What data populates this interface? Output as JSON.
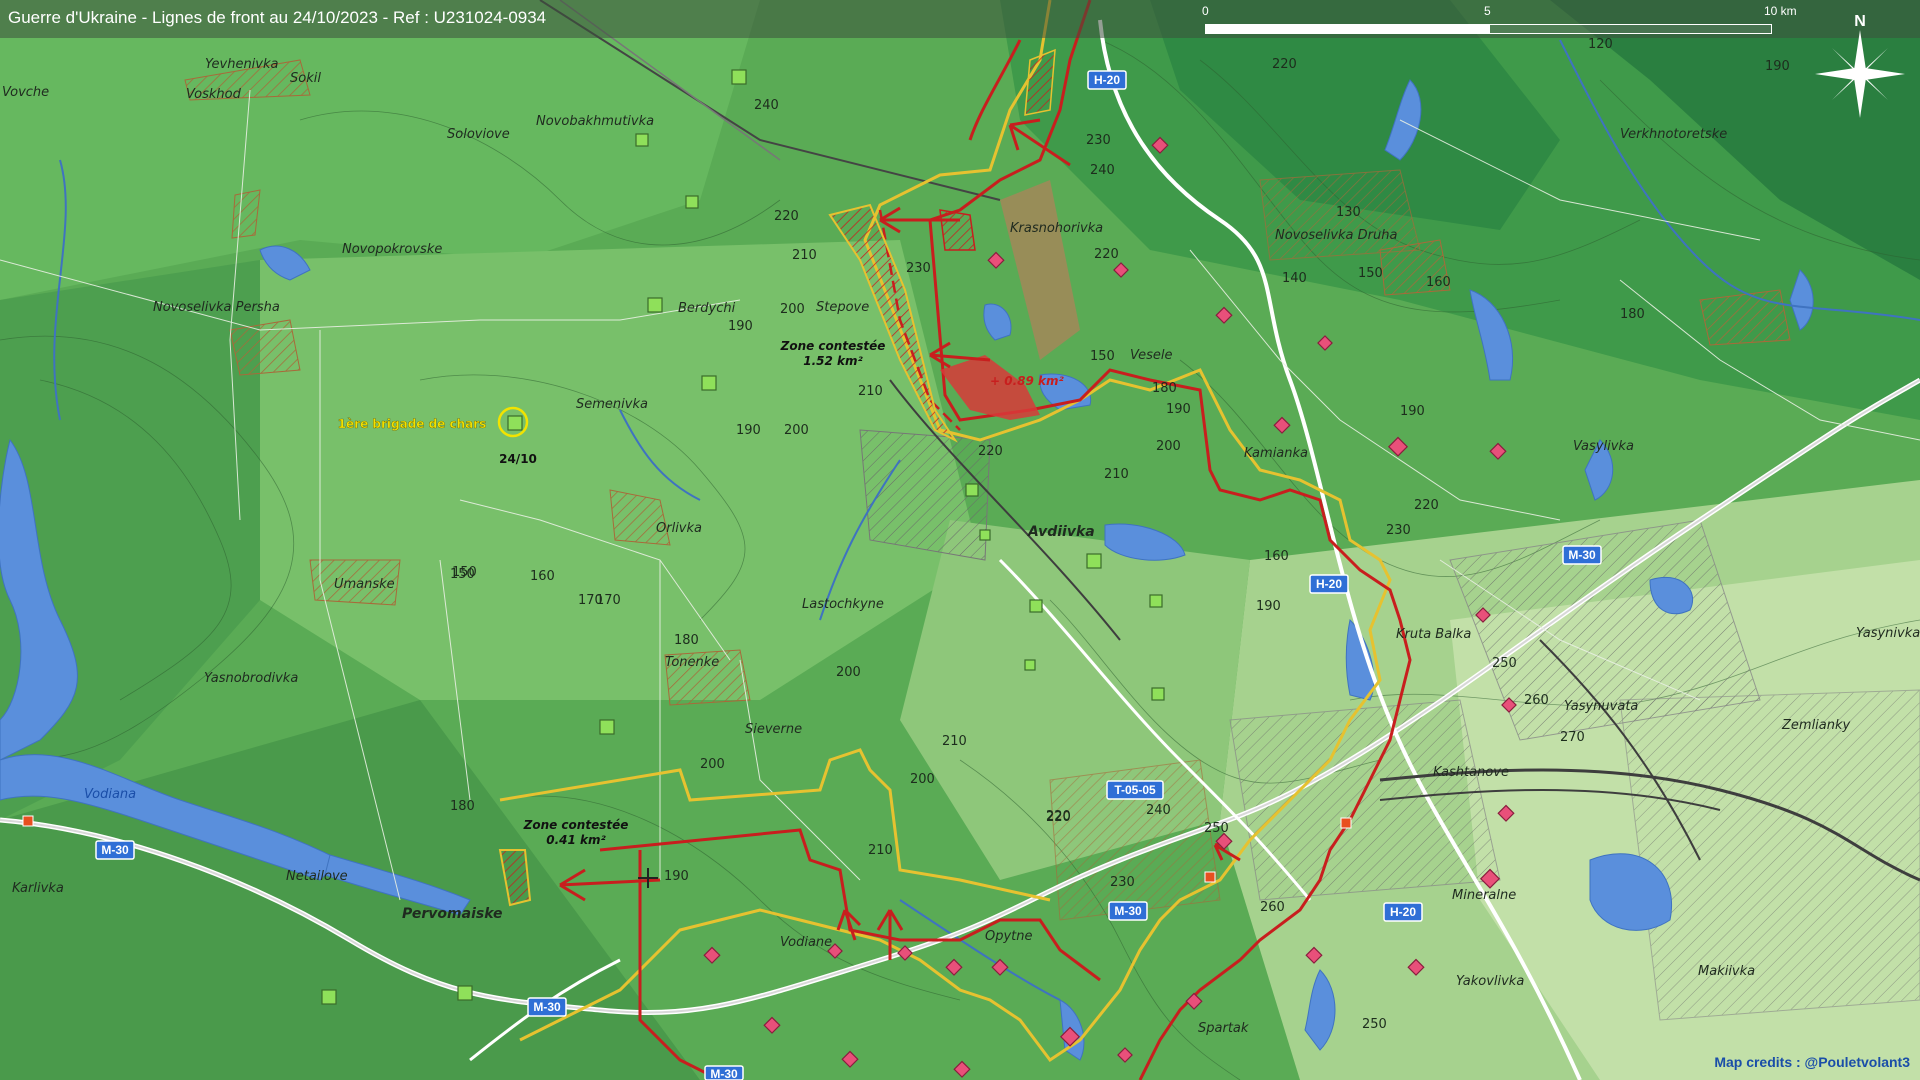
{
  "title": "Guerre d'Ukraine - Lignes de front au 24/10/2023 - Ref : U231024-0934",
  "scale": {
    "ticks": [
      "0",
      "5",
      "10 km"
    ]
  },
  "north_label": "N",
  "credits": "Map credits : @Pouletvolant3",
  "places": [
    "Vovche",
    "Yevhenivka",
    "Sokil",
    "Voskhod",
    "Soloviove",
    "Novobakhmutivka",
    "Novopokrovske",
    "Novoselivka Persha",
    "Berdychi",
    "Stepove",
    "Krasnohorivka",
    "Novoselivka Druha",
    "Verkhnotoretske",
    "Vesele",
    "Semenivka",
    "Kamianka",
    "Vasylivka",
    "Orlivka",
    "Avdiivka",
    "Umanske",
    "Lastochkyne",
    "Kruta Balka",
    "Yasynivka",
    "Tonenke",
    "Yasnobrodivka",
    "Yasynuvata",
    "Sieverne",
    "Zemlianky",
    "Kashtanove",
    "Vodiana",
    "Karlivka",
    "Netailove",
    "Pervomaiske",
    "Vodiane",
    "Opytne",
    "Mineralne",
    "Yakovlivka",
    "Makiivka",
    "Spartak"
  ],
  "roads": [
    "H-20",
    "M-30",
    "T-05-05"
  ],
  "annotations": {
    "zone1": "Zone contestée",
    "zone1_area": "1.52 km²",
    "zone2": "Zone contestée",
    "zone2_area": "0.41 km²",
    "gain": "+ 0.89 km²",
    "brigade": "1ère brigade de chars",
    "brigade_date": "24/10"
  },
  "elevations": [
    "240",
    "220",
    "120",
    "190",
    "230",
    "240",
    "220",
    "210",
    "230",
    "220",
    "130",
    "140",
    "150",
    "160",
    "200",
    "190",
    "150",
    "180",
    "190",
    "200",
    "210",
    "220",
    "230",
    "160",
    "150",
    "170",
    "180",
    "190",
    "200",
    "210",
    "220",
    "250",
    "260",
    "270",
    "180",
    "190",
    "170",
    "160",
    "150",
    "190",
    "200",
    "210",
    "220",
    "230",
    "240",
    "250",
    "260",
    "250",
    "200",
    "210",
    "220",
    "190",
    "180",
    "200"
  ],
  "colors": {
    "front_line": "#c81e1e",
    "contested": "#e6c230",
    "russian_units": "#e8507a",
    "ukrainian_units": "#8fe05a"
  }
}
